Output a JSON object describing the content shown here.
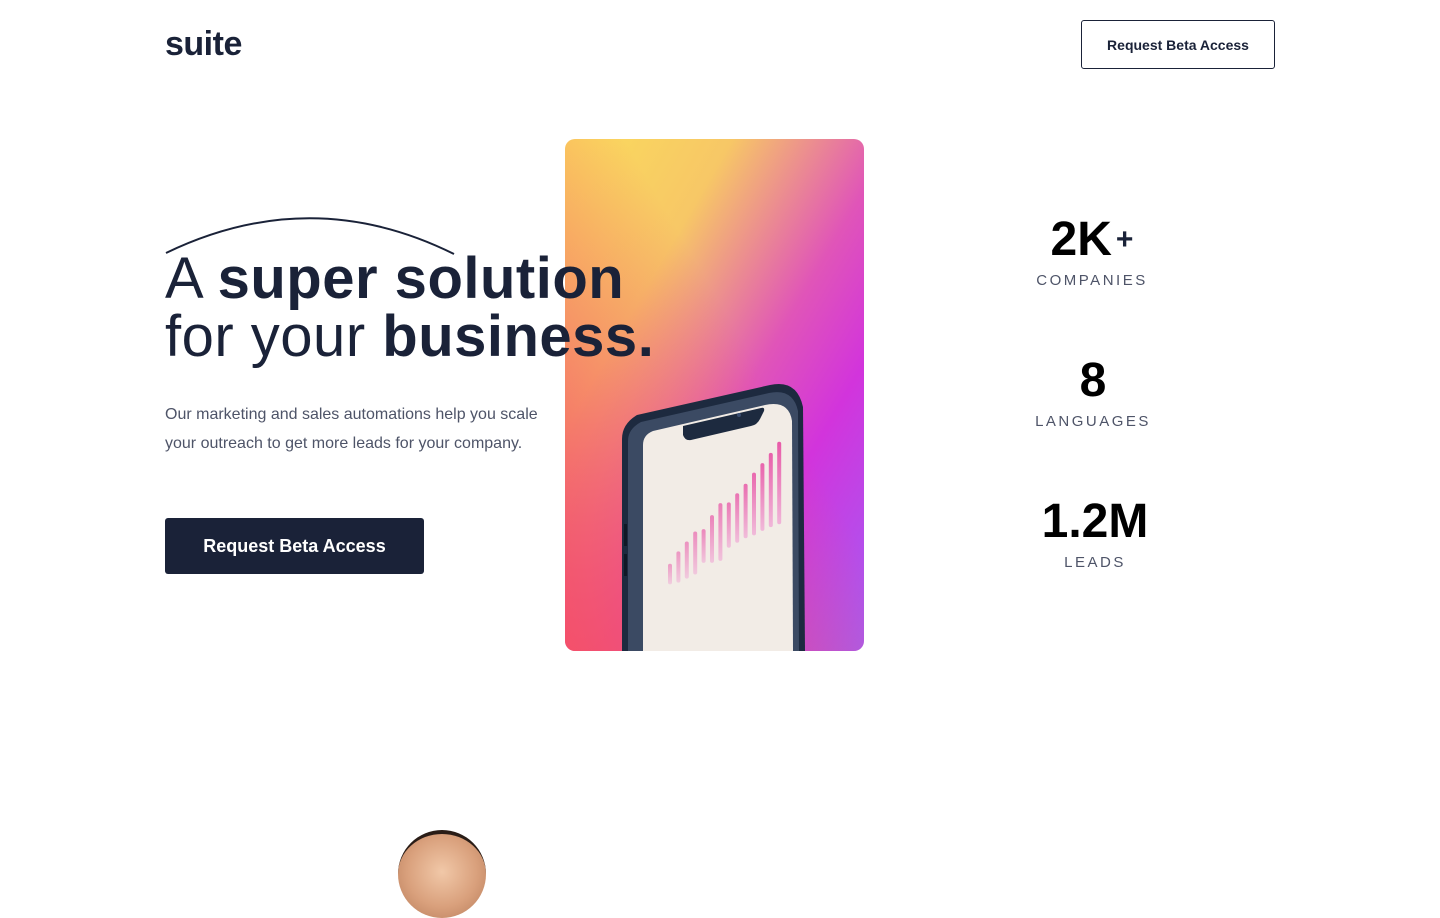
{
  "header": {
    "logo": "suite",
    "cta_label": "Request Beta Access"
  },
  "hero": {
    "headline_line1_regular": "A",
    "headline_line1_bold": "super solution",
    "headline_line2_regular": "for your",
    "headline_line2_bold": "business.",
    "description": "Our marketing and sales automations help you scale your outreach to get more leads for your company.",
    "cta_label": "Request Beta Access",
    "chart_bars": [
      0.25,
      0.38,
      0.45,
      0.52,
      0.41,
      0.58,
      0.7,
      0.55,
      0.6,
      0.66,
      0.76,
      0.82,
      0.9,
      1.0
    ]
  },
  "stats": [
    {
      "value": "2K",
      "suffix": "+",
      "label": "COMPANIES"
    },
    {
      "value": "8",
      "suffix": "",
      "label": "LANGUAGES"
    },
    {
      "value": "1.2M",
      "suffix": "",
      "label": "LEADS"
    }
  ],
  "colors": {
    "brand_navy": "#1a2238",
    "text_muted": "#4e5468",
    "gradient_yellow": "#fbdc5c",
    "gradient_magenta": "#d234dc",
    "gradient_red": "#f4506a",
    "gradient_violet": "#a45cf4",
    "bar_pink": "#e85aa8"
  }
}
